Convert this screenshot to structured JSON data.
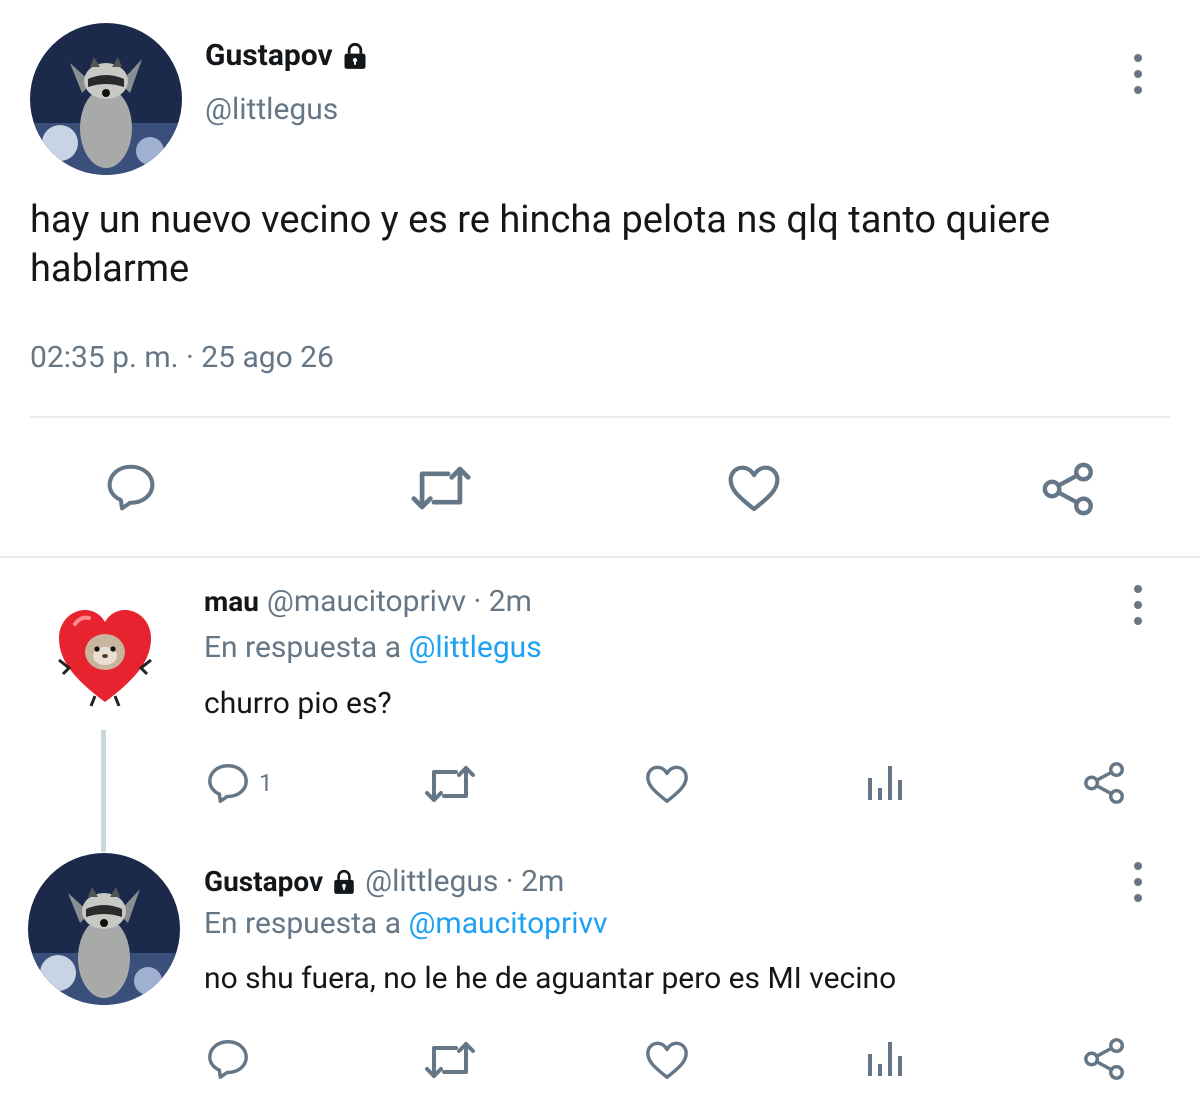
{
  "main_tweet": {
    "name": "Gustapov",
    "handle": "@littlegus",
    "text": "hay un nuevo vecino y es re hincha pelota ns qlq tanto quiere hablarme",
    "timestamp": "02:35 p. m. · 25 ago 26",
    "actions": [
      "reply-icon",
      "retweet-icon",
      "like-icon",
      "share-icon"
    ]
  },
  "replies": [
    {
      "name": "mau",
      "handle_time": "@maucitoprivv · 2m",
      "in_reply_prefix": "En respuesta a ",
      "in_reply_to": "@littlegus",
      "text": "churro pio es?",
      "reply_count": "1"
    },
    {
      "name": "Gustapov",
      "handle_time": "@littlegus · 2m",
      "in_reply_prefix": "En respuesta a ",
      "in_reply_to": "@maucitoprivv",
      "text": "no shu fuera, no le he de aguantar pero es MI vecino",
      "reply_count": ""
    }
  ],
  "colors": {
    "text": "#14171a",
    "secondary": "#657786",
    "link": "#1da1f2",
    "divider": "#e6ecf0"
  }
}
